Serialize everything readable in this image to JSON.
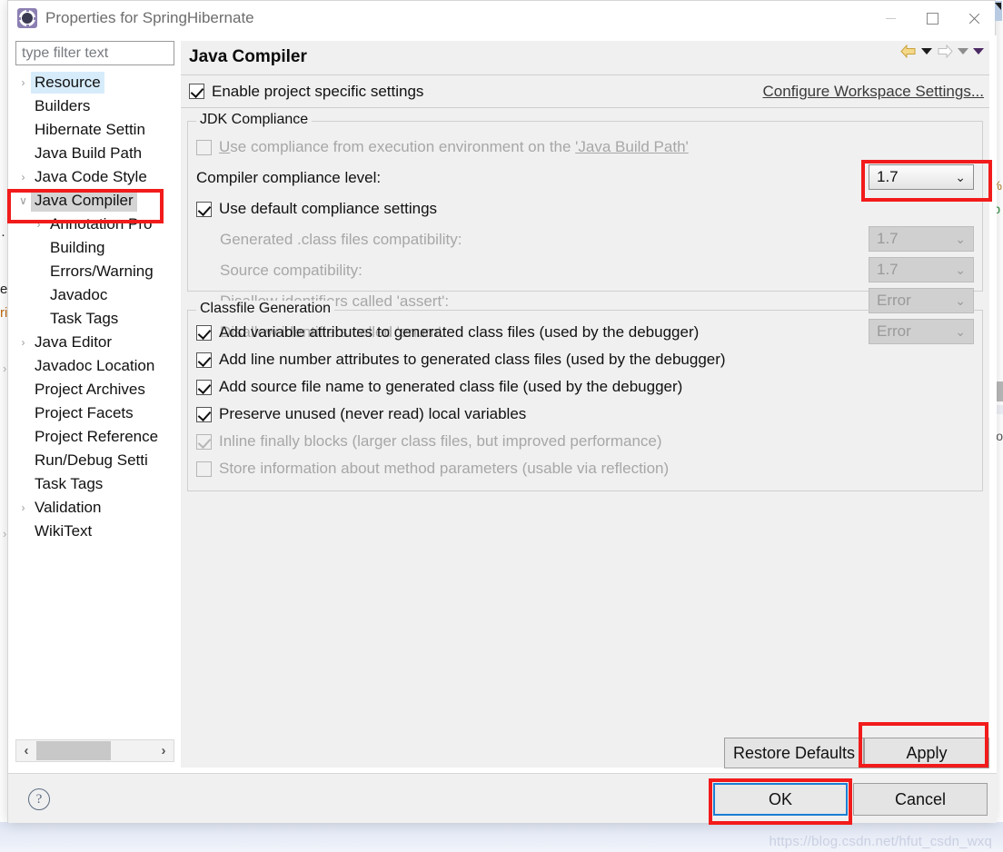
{
  "window": {
    "title": "Properties for SpringHibernate",
    "icon": "eclipse-gear-icon",
    "minimize_label": "—",
    "maximize_label": "□",
    "close_label": "✕"
  },
  "sidebar": {
    "filter": {
      "placeholder": "type filter text",
      "value": ""
    },
    "items": [
      {
        "label": "Resource",
        "twisty": "›",
        "indent": 0,
        "state": "sel-blue"
      },
      {
        "label": "Builders",
        "twisty": "",
        "indent": 0,
        "state": ""
      },
      {
        "label": "Hibernate Settin",
        "twisty": "",
        "indent": 0,
        "state": ""
      },
      {
        "label": "Java Build Path",
        "twisty": "",
        "indent": 0,
        "state": ""
      },
      {
        "label": "Java Code Style",
        "twisty": "›",
        "indent": 0,
        "state": ""
      },
      {
        "label": "Java Compiler",
        "twisty": "∨",
        "indent": 0,
        "state": "sel-grey"
      },
      {
        "label": "Annotation Pro",
        "twisty": "›",
        "indent": 1,
        "state": ""
      },
      {
        "label": "Building",
        "twisty": "",
        "indent": 1,
        "state": ""
      },
      {
        "label": "Errors/Warning",
        "twisty": "",
        "indent": 1,
        "state": ""
      },
      {
        "label": "Javadoc",
        "twisty": "",
        "indent": 1,
        "state": ""
      },
      {
        "label": "Task Tags",
        "twisty": "",
        "indent": 1,
        "state": ""
      },
      {
        "label": "Java Editor",
        "twisty": "›",
        "indent": 0,
        "state": ""
      },
      {
        "label": "Javadoc Location",
        "twisty": "",
        "indent": 0,
        "state": ""
      },
      {
        "label": "Project Archives",
        "twisty": "",
        "indent": 0,
        "state": ""
      },
      {
        "label": "Project Facets",
        "twisty": "",
        "indent": 0,
        "state": ""
      },
      {
        "label": "Project Reference",
        "twisty": "",
        "indent": 0,
        "state": ""
      },
      {
        "label": "Run/Debug Setti",
        "twisty": "",
        "indent": 0,
        "state": ""
      },
      {
        "label": "Task Tags",
        "twisty": "",
        "indent": 0,
        "state": ""
      },
      {
        "label": "Validation",
        "twisty": "›",
        "indent": 0,
        "state": ""
      },
      {
        "label": "WikiText",
        "twisty": "",
        "indent": 0,
        "state": ""
      }
    ],
    "scroll": {
      "left_arrow": "‹",
      "right_arrow": "›"
    }
  },
  "content": {
    "title": "Java Compiler",
    "nav": {
      "back_icon": "back-arrow-icon",
      "back_menu_icon": "caret-down-icon",
      "forward_icon": "forward-arrow-icon",
      "forward_menu_icon": "caret-down-icon",
      "extra_menu_icon": "caret-down-icon"
    },
    "enable_project_specific": {
      "label": "Enable project specific settings",
      "checked": true
    },
    "configure_workspace_link": "Configure Workspace Settings...",
    "jdk_group": {
      "title": "JDK Compliance",
      "use_execution_env": {
        "label_prefix": "U",
        "label_rest": "se compliance from execution environment on the ",
        "link_text": "'Java Build Path'",
        "checked": false,
        "disabled": true
      },
      "compliance_level": {
        "label": "Compiler compliance level:",
        "value": "1.7",
        "disabled": false,
        "highlighted": true
      },
      "use_default_compliance": {
        "label": "Use default compliance settings",
        "checked": true
      },
      "rows": [
        {
          "label": "Generated .class files compatibility:",
          "value": "1.7",
          "disabled": true
        },
        {
          "label": "Source compatibility:",
          "value": "1.7",
          "disabled": true
        },
        {
          "label": "Disallow identifiers called 'assert':",
          "value": "Error",
          "disabled": true
        },
        {
          "label": "Disallow identifiers called 'enum':",
          "value": "Error",
          "disabled": true
        }
      ]
    },
    "classfile_group": {
      "title": "Classfile Generation",
      "options": [
        {
          "label": "Add variable attributes to generated class files (used by the debugger)",
          "checked": true,
          "disabled": false
        },
        {
          "label": "Add line number attributes to generated class files (used by the debugger)",
          "checked": true,
          "disabled": false
        },
        {
          "label": "Add source file name to generated class file (used by the debugger)",
          "checked": true,
          "disabled": false
        },
        {
          "label": "Preserve unused (never read) local variables",
          "checked": true,
          "disabled": false
        },
        {
          "label": "Inline finally blocks (larger class files, but improved performance)",
          "checked": true,
          "disabled": true
        },
        {
          "label": "Store information about method parameters (usable via reflection)",
          "checked": false,
          "disabled": true
        }
      ]
    },
    "restore_defaults_label": "Restore Defaults",
    "apply_label": "Apply"
  },
  "footer": {
    "help_icon": "question-mark-icon",
    "ok_label": "OK",
    "cancel_label": "Cancel"
  },
  "annotations": {
    "highlight_color": "#f21b1b",
    "highlighted": [
      "java-compiler-tree-item",
      "compliance-level-combo",
      "apply-button",
      "ok-button"
    ]
  },
  "background": {
    "watermark": "https://blog.csdn.net/hfut_csdn_wxq",
    "right_fragment": "Co",
    "left_fragments": [
      "·",
      "e",
      "ri"
    ],
    "right_symbols": [
      "%",
      "p"
    ]
  }
}
